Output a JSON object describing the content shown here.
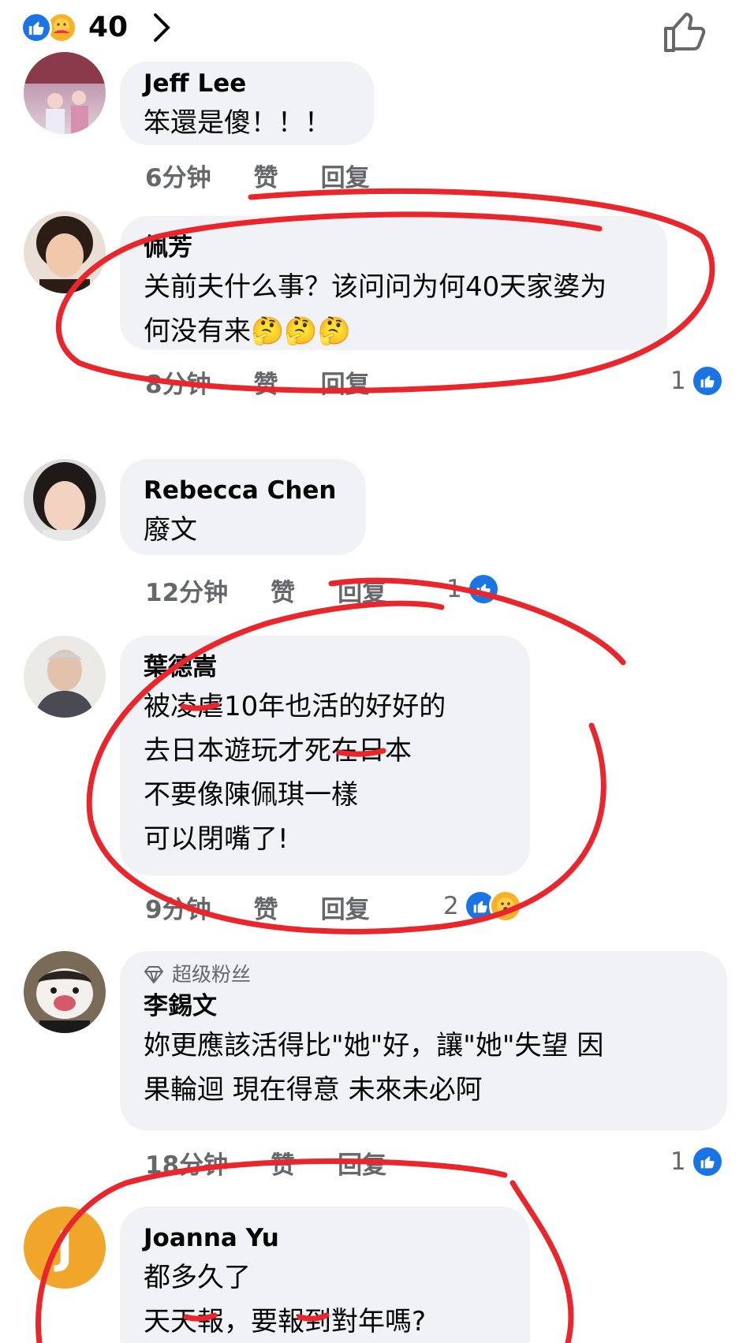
{
  "header": {
    "reaction_count": "40"
  },
  "comments": [
    {
      "name": "Jeff Lee",
      "text": "笨還是傻！！！",
      "time": "6分钟",
      "like": "赞",
      "reply": "回复",
      "likes": ""
    },
    {
      "name": "佩芳",
      "text": "关前夫什么事？该问问为何40天家婆为\n何没有来🤔🤔🤔",
      "time": "8分钟",
      "like": "赞",
      "reply": "回复",
      "likes": "1"
    },
    {
      "name": "Rebecca Chen",
      "text": "廢文",
      "time": "12分钟",
      "like": "赞",
      "reply": "回复",
      "likes": "1"
    },
    {
      "name": "葉德嵩",
      "text": "被凌虐10年也活的好好的\n去日本遊玩才死在日本\n不要像陳佩琪一樣\n可以閉嘴了!",
      "time": "9分钟",
      "like": "赞",
      "reply": "回复",
      "likes": "2"
    },
    {
      "badge": "超级粉丝",
      "name": "李錫文",
      "text": "妳更應該活得比\"她\"好，讓\"她\"失望  因\n果輪迴  現在得意  未來未必阿",
      "time": "18分钟",
      "like": "赞",
      "reply": "回复",
      "likes": "1"
    },
    {
      "name": "Joanna Yu",
      "avatar_letter": "J",
      "text": "都多久了\n天天報，要報到對年嗎?"
    }
  ],
  "colors": {
    "accent": "#1b74e4",
    "bubble": "#f0f2f5",
    "meta": "#65676b",
    "annotation": "#e8262b"
  }
}
